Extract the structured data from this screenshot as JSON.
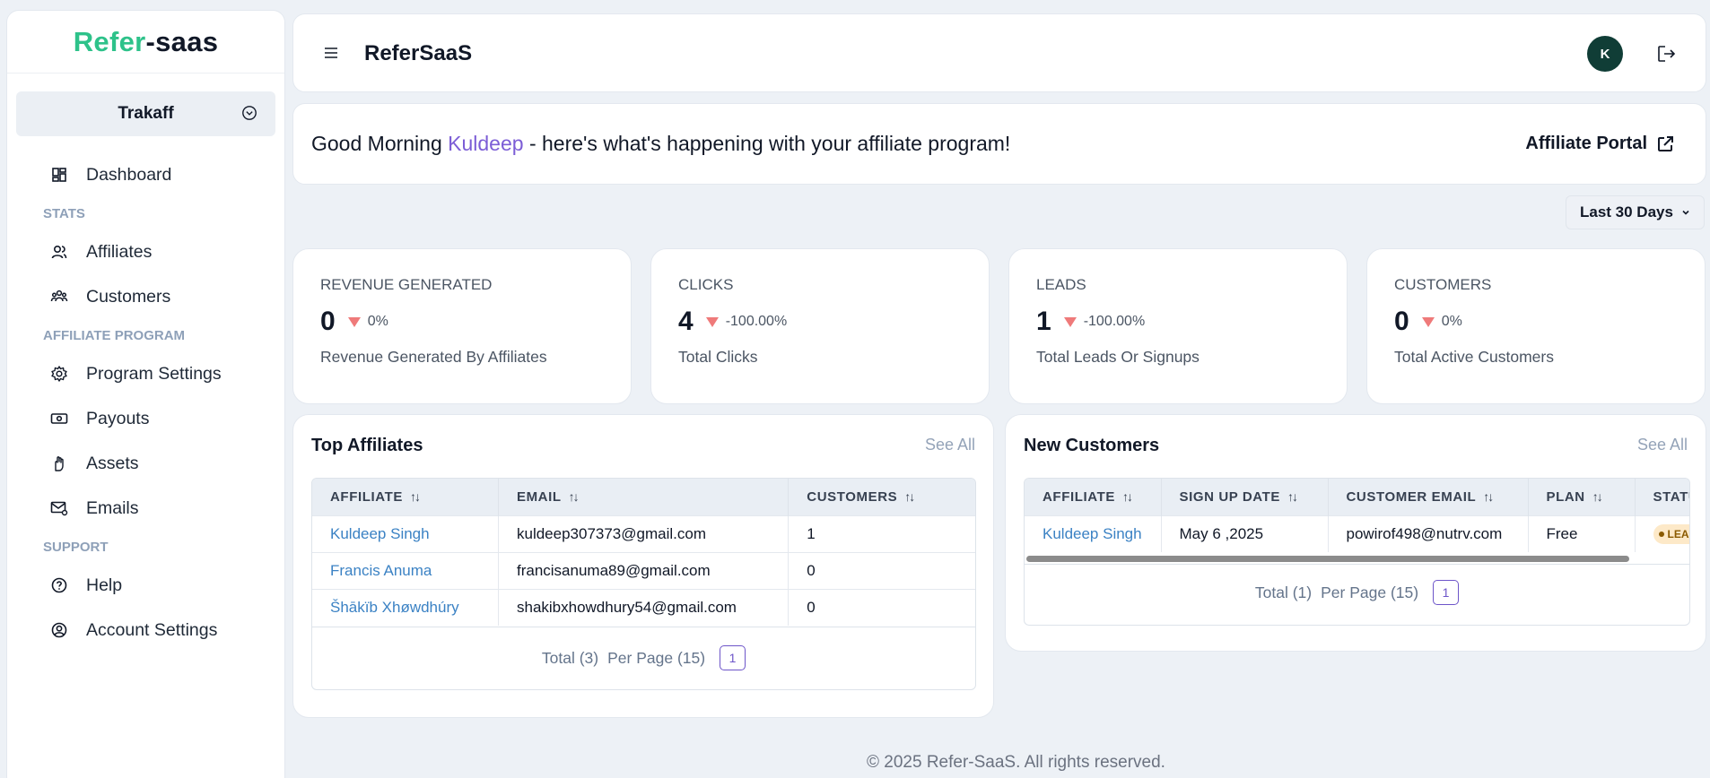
{
  "sidebar": {
    "logo_part1": "Refer",
    "logo_part2": "-saas",
    "workspace": "Trakaff",
    "dashboard": "Dashboard",
    "section_stats": "STATS",
    "affiliates": "Affiliates",
    "customers": "Customers",
    "section_program": "AFFILIATE PROGRAM",
    "program_settings": "Program Settings",
    "payouts": "Payouts",
    "assets": "Assets",
    "emails": "Emails",
    "section_support": "SUPPORT",
    "help": "Help",
    "account_settings": "Account Settings"
  },
  "header": {
    "title": "ReferSaaS",
    "avatar_initial": "K"
  },
  "welcome": {
    "greeting": "Good Morning ",
    "name": "Kuldeep",
    "rest": " - here's what's happening with your affiliate program!",
    "portal_label": "Affiliate Portal"
  },
  "date_filter": "Last 30 Days",
  "stats": [
    {
      "title": "REVENUE GENERATED",
      "value": "0",
      "change": "0%",
      "desc": "Revenue Generated By Affiliates"
    },
    {
      "title": "CLICKS",
      "value": "4",
      "change": "-100.00%",
      "desc": "Total Clicks"
    },
    {
      "title": "LEADS",
      "value": "1",
      "change": "-100.00%",
      "desc": "Total Leads Or Signups"
    },
    {
      "title": "CUSTOMERS",
      "value": "0",
      "change": "0%",
      "desc": "Total Active Customers"
    }
  ],
  "top_affiliates": {
    "title": "Top Affiliates",
    "see_all": "See All",
    "columns": [
      "AFFILIATE",
      "EMAIL",
      "CUSTOMERS"
    ],
    "rows": [
      {
        "affiliate": "Kuldeep Singh",
        "email": "kuldeep307373@gmail.com",
        "customers": "1"
      },
      {
        "affiliate": "Francis Anuma",
        "email": "francisanuma89@gmail.com",
        "customers": "0"
      },
      {
        "affiliate": "Šhākïb Xhøwdhúry",
        "email": "shakibxhowdhury54@gmail.com",
        "customers": "0"
      }
    ],
    "total": "Total (3)",
    "per_page": "Per Page (15)",
    "page": "1"
  },
  "new_customers": {
    "title": "New Customers",
    "see_all": "See All",
    "columns": [
      "AFFILIATE",
      "SIGN UP DATE",
      "CUSTOMER EMAIL",
      "PLAN",
      "STATUS"
    ],
    "rows": [
      {
        "affiliate": "Kuldeep Singh",
        "date": "May 6 ,2025",
        "email": "powirof498@nutrv.com",
        "plan": "Free",
        "status": "LEAD"
      }
    ],
    "total": "Total (1)",
    "per_page": "Per Page (15)",
    "page": "1"
  },
  "footer": "© 2025 Refer-SaaS. All rights reserved.",
  "colors": {
    "brand_green": "#2ec28a",
    "accent_purple": "#7c5dd6",
    "link_blue": "#3b82c4",
    "avatar_bg": "#103d36",
    "down_red": "#ef7a7a"
  }
}
